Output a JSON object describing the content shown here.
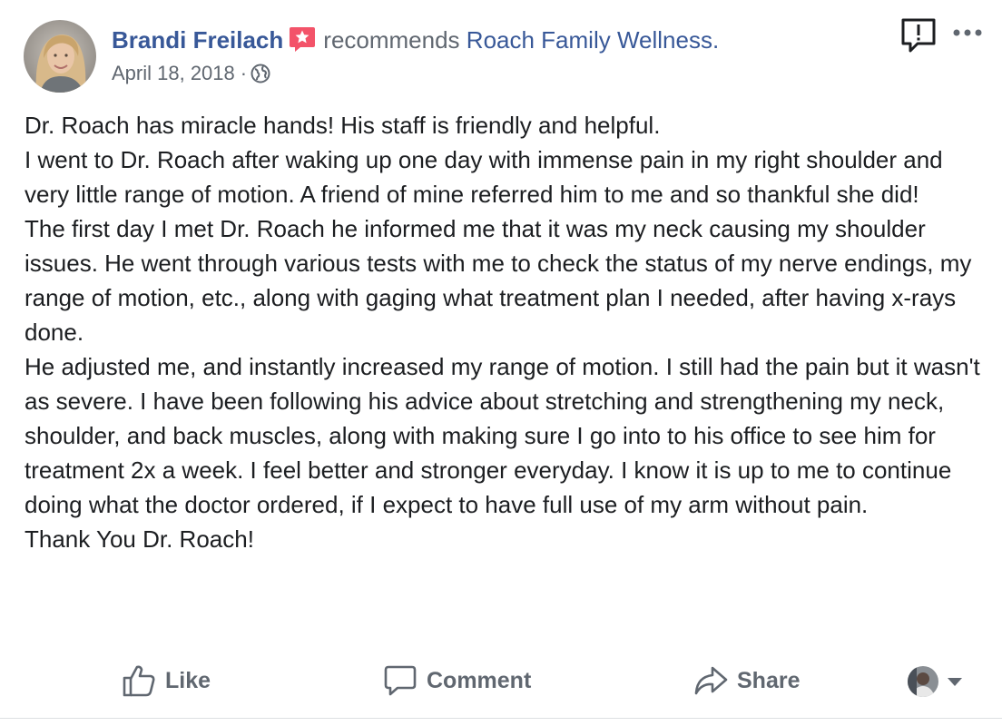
{
  "post": {
    "author_name": "Brandi Freilach",
    "recommends_text": "recommends",
    "page_name": "Roach Family Wellness",
    "page_suffix": ".",
    "date": "April 18, 2018",
    "separator": "·",
    "privacy_icon": "globe-icon",
    "badge_icon": "recommendation-star-icon",
    "body_paragraphs": [
      "Dr. Roach has miracle hands! His staff is friendly and helpful.",
      "I went to Dr. Roach after waking up one day with immense pain in my right shoulder and very little range of motion. A friend of mine referred him to me and so thankful she did!",
      "The first day I met Dr. Roach he informed me that it was my neck causing my shoulder issues. He went through various tests with me to check the status of my nerve endings, my range of motion, etc., along with gaging what treatment plan I needed, after having x-rays done.",
      "He adjusted me, and instantly increased my range of motion. I still had the pain but it wasn't as severe. I have been following his advice about stretching and strengthening my neck, shoulder, and back muscles, along with making sure I go into to his office to see him for treatment 2x a week. I feel better and stronger everyday. I know it is up to me to continue doing what the doctor ordered, if I expect to have full use of my arm without pain.",
      "Thank You Dr. Roach!"
    ]
  },
  "actions": {
    "like_label": "Like",
    "comment_label": "Comment",
    "share_label": "Share"
  },
  "icons": {
    "report": "report-icon",
    "more": "more-options-icon",
    "like": "thumbs-up-icon",
    "comment": "comment-bubble-icon",
    "share": "share-arrow-icon",
    "caret": "chevron-down-icon"
  },
  "colors": {
    "link": "#385898",
    "secondary_text": "#606770",
    "body_text": "#1c1e21",
    "badge": "#f35369"
  }
}
